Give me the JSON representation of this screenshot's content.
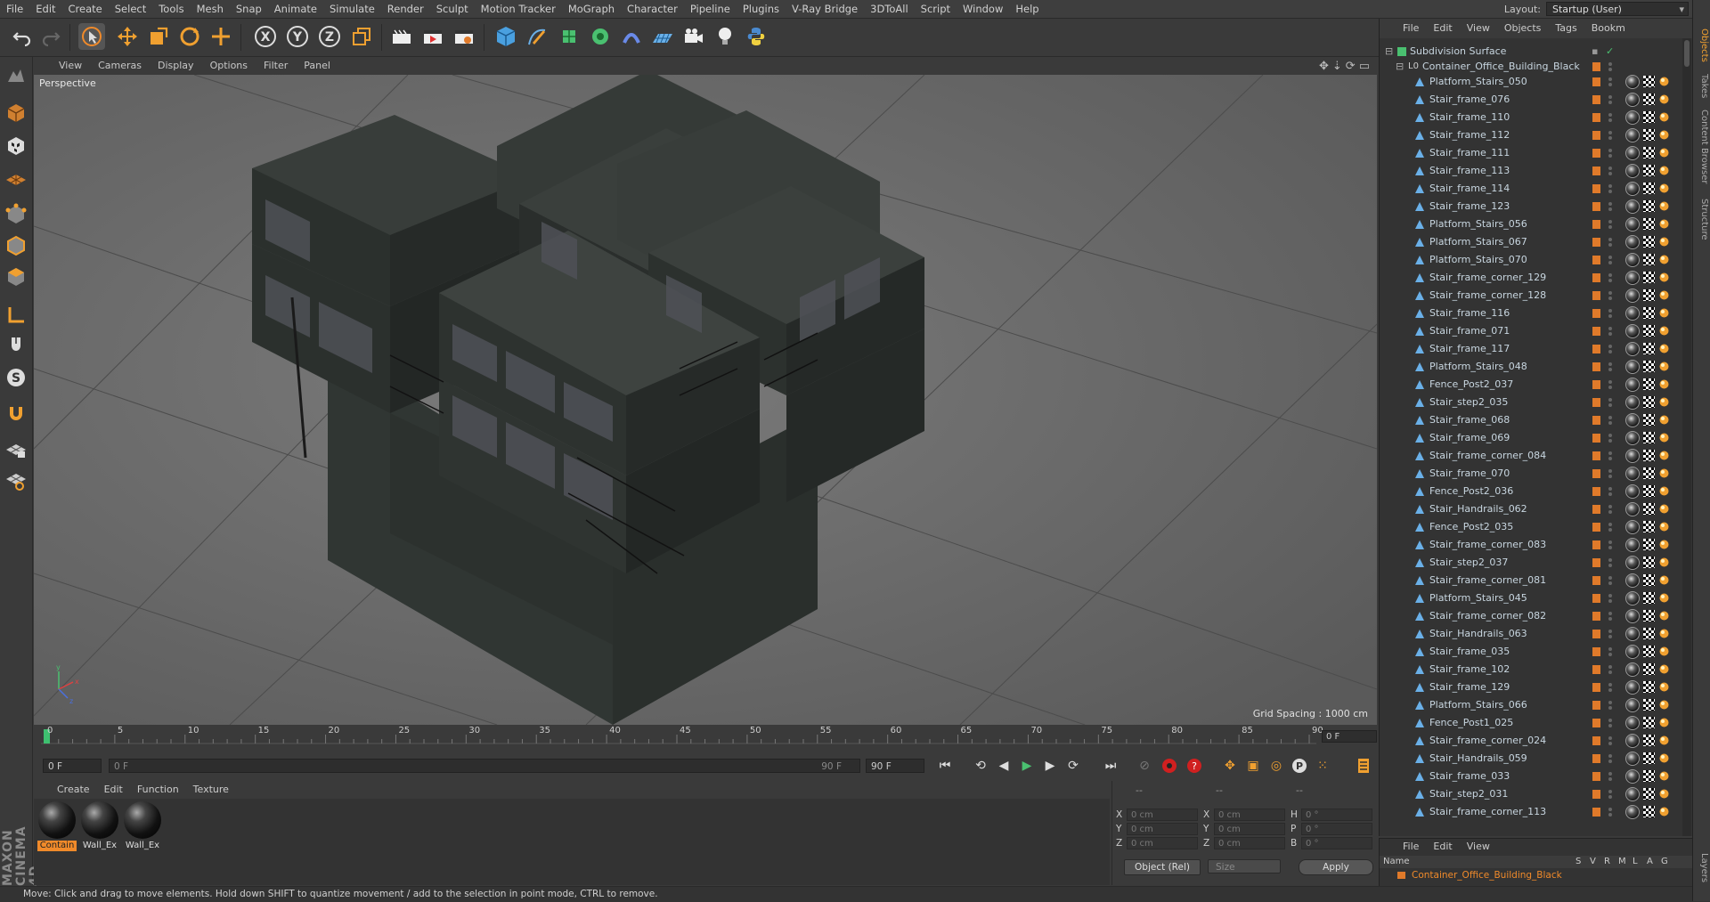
{
  "menubar": {
    "items": [
      "File",
      "Edit",
      "Create",
      "Select",
      "Tools",
      "Mesh",
      "Snap",
      "Animate",
      "Simulate",
      "Render",
      "Sculpt",
      "Motion Tracker",
      "MoGraph",
      "Character",
      "Pipeline",
      "Plugins",
      "V-Ray Bridge",
      "3DToAll",
      "Script",
      "Window",
      "Help"
    ],
    "layout_label": "Layout:",
    "layout_value": "Startup (User)"
  },
  "viewport": {
    "menu": [
      "View",
      "Cameras",
      "Display",
      "Options",
      "Filter",
      "Panel"
    ],
    "label": "Perspective",
    "grid_spacing": "Grid Spacing : 1000 cm"
  },
  "timeline": {
    "ticks": [
      "0",
      "5",
      "10",
      "15",
      "20",
      "25",
      "30",
      "35",
      "40",
      "45",
      "50",
      "55",
      "60",
      "65",
      "70",
      "75",
      "80",
      "85",
      "90"
    ],
    "frame_counter": "0 F"
  },
  "transport": {
    "start_field": "0 F",
    "range_left": "0 F",
    "range_right": "90 F",
    "end_field": "90 F"
  },
  "materials": {
    "menu": [
      "Create",
      "Edit",
      "Function",
      "Texture"
    ],
    "items": [
      {
        "label": "Contain",
        "selected": true
      },
      {
        "label": "Wall_Ex",
        "selected": false
      },
      {
        "label": "Wall_Ex",
        "selected": false
      }
    ]
  },
  "coords": {
    "headers": [
      "--",
      "--",
      "--"
    ],
    "rows": [
      {
        "a1": "X",
        "v1": "0 cm",
        "a2": "X",
        "v2": "0 cm",
        "a3": "H",
        "v3": "0 °"
      },
      {
        "a1": "Y",
        "v1": "0 cm",
        "a2": "Y",
        "v2": "0 cm",
        "a3": "P",
        "v3": "0 °"
      },
      {
        "a1": "Z",
        "v1": "0 cm",
        "a2": "Z",
        "v2": "0 cm",
        "a3": "B",
        "v3": "0 °"
      }
    ],
    "mode": "Object (Rel)",
    "size": "Size",
    "apply": "Apply"
  },
  "status": "Move: Click and drag to move elements. Hold down SHIFT to quantize movement / add to the selection in point mode, CTRL to remove.",
  "object_manager": {
    "menu": [
      "File",
      "Edit",
      "View",
      "Objects",
      "Tags",
      "Bookm"
    ],
    "root": "Subdivision Surface",
    "group": "Container_Office_Building_Black",
    "objects": [
      "Platform_Stairs_050",
      "Stair_frame_076",
      "Stair_frame_110",
      "Stair_frame_112",
      "Stair_frame_111",
      "Stair_frame_113",
      "Stair_frame_114",
      "Stair_frame_123",
      "Platform_Stairs_056",
      "Platform_Stairs_067",
      "Platform_Stairs_070",
      "Stair_frame_corner_129",
      "Stair_frame_corner_128",
      "Stair_frame_116",
      "Stair_frame_071",
      "Stair_frame_117",
      "Platform_Stairs_048",
      "Fence_Post2_037",
      "Stair_step2_035",
      "Stair_frame_068",
      "Stair_frame_069",
      "Stair_frame_corner_084",
      "Stair_frame_070",
      "Fence_Post2_036",
      "Stair_Handrails_062",
      "Fence_Post2_035",
      "Stair_frame_corner_083",
      "Stair_step2_037",
      "Stair_frame_corner_081",
      "Platform_Stairs_045",
      "Stair_frame_corner_082",
      "Stair_Handrails_063",
      "Stair_frame_035",
      "Stair_frame_102",
      "Stair_frame_129",
      "Platform_Stairs_066",
      "Fence_Post1_025",
      "Stair_frame_corner_024",
      "Stair_Handrails_059",
      "Stair_frame_033",
      "Stair_step2_031",
      "Stair_frame_corner_113"
    ]
  },
  "layer_manager": {
    "menu": [
      "File",
      "Edit",
      "View"
    ],
    "header_name": "Name",
    "header_cols": [
      "S",
      "V",
      "R",
      "M",
      "L",
      "A",
      "G"
    ],
    "row": "Container_Office_Building_Black"
  },
  "side_tabs": [
    "Objects",
    "Takes",
    "Content Browser",
    "Structure",
    "Layers"
  ],
  "colors": {
    "accent": "#f08a2a",
    "layer": "#e07a2a",
    "bg": "#3a3a3a"
  }
}
